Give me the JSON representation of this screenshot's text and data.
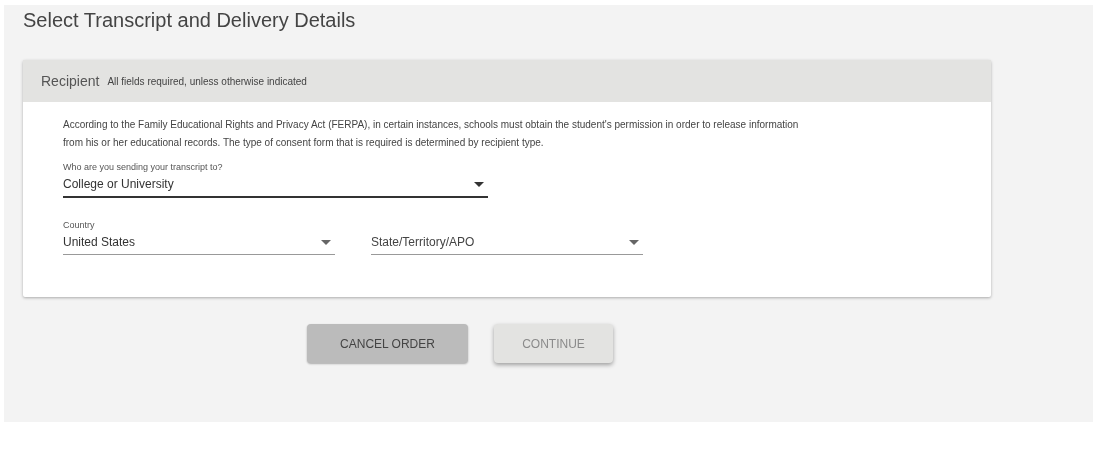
{
  "page": {
    "title": "Select Transcript and Delivery Details"
  },
  "card": {
    "title": "Recipient",
    "subtitle": "All fields required, unless otherwise indicated",
    "intro": "According to the Family Educational Rights and Privacy Act (FERPA), in certain instances, schools must obtain the student's permission in order to release information from his or her educational records. The type of consent form that is required is determined by recipient type.",
    "rows": [
      [
        {
          "label": "Who are you sending your transcript to?",
          "value": "College or University",
          "focused": true,
          "kind": "wide"
        }
      ],
      [
        {
          "label": "Country",
          "value": "United States",
          "focused": false,
          "kind": "half"
        },
        {
          "placeholder": "State/Territory/APO",
          "focused": false,
          "kind": "half"
        }
      ]
    ]
  },
  "buttons": [
    {
      "label": "CANCEL ORDER",
      "kind": "cancel",
      "disabled": false
    },
    {
      "label": "CONTINUE",
      "kind": "continue",
      "disabled": true
    }
  ]
}
